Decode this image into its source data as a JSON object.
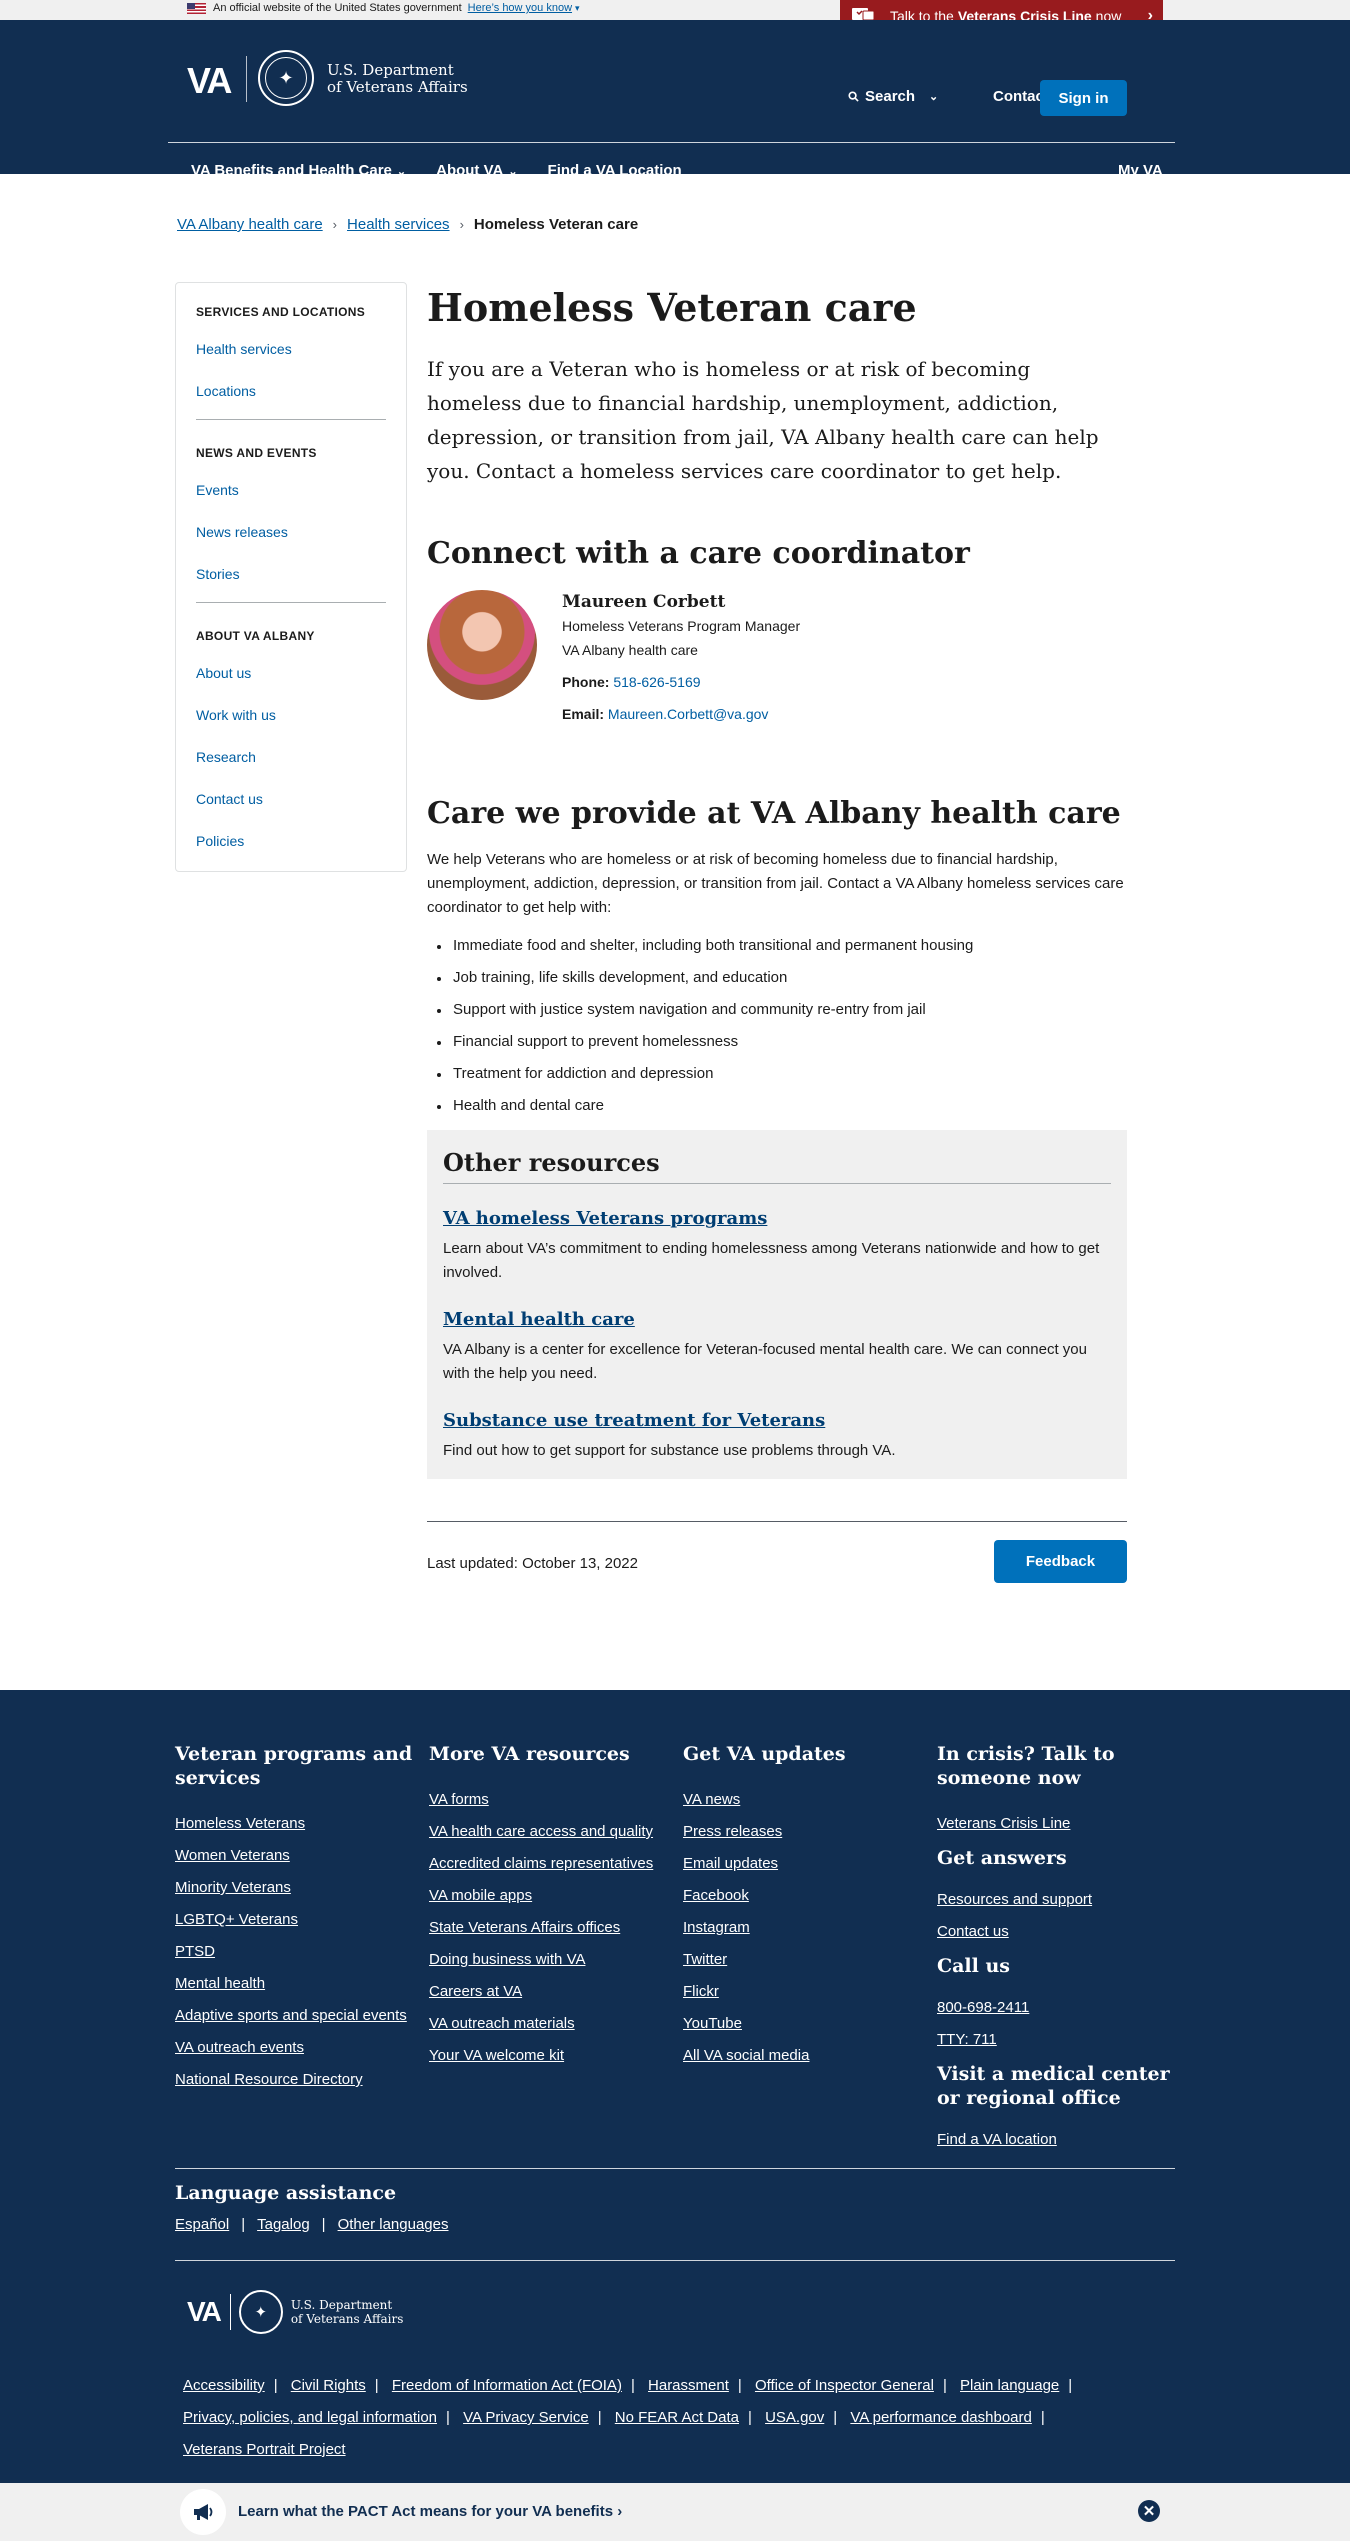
{
  "gov_banner": {
    "text": "An official website of the United States government",
    "how_know": "Here’s how you know"
  },
  "crisis_line": {
    "prefix": "Talk to the",
    "bold": "Veterans Crisis Line",
    "suffix": "now"
  },
  "header": {
    "logo_va": "VA",
    "logo_line1": "U.S. Department",
    "logo_line2": "of Veterans Affairs",
    "search": "Search",
    "contact": "Contact us",
    "signin": "Sign in",
    "nav": [
      "VA Benefits and Health Care",
      "About VA",
      "Find a VA Location"
    ],
    "myva": "My VA"
  },
  "breadcrumb": [
    "VA Albany health care",
    "Health services",
    "Homeless Veteran care"
  ],
  "sidebar": {
    "sections": [
      {
        "title": "SERVICES AND LOCATIONS",
        "links": [
          "Health services",
          "Locations"
        ]
      },
      {
        "title": "NEWS AND EVENTS",
        "links": [
          "Events",
          "News releases",
          "Stories"
        ]
      },
      {
        "title": "ABOUT VA ALBANY",
        "links": [
          "About us",
          "Work with us",
          "Research",
          "Contact us",
          "Policies"
        ]
      }
    ]
  },
  "main": {
    "title": "Homeless Veteran care",
    "lead": "If you are a Veteran who is homeless or at risk of becoming homeless due to financial hardship, unemployment, addiction, depression, or transition from jail, VA Albany health care can help you. Contact a homeless services care coordinator to get help.",
    "connect_heading": "Connect with a care coordinator",
    "coordinator": {
      "name": "Maureen Corbett",
      "role": "Homeless Veterans Program Manager",
      "facility": "VA Albany health care",
      "phone_label": "Phone:",
      "phone": "518-626-5169",
      "email_label": "Email:",
      "email": "Maureen.Corbett@va.gov"
    },
    "care_heading": "Care we provide at VA Albany health care",
    "care_intro": "We help Veterans who are homeless or at risk of becoming homeless due to financial hardship, unemployment, addiction, depression, or transition from jail. Contact a VA Albany homeless services care coordinator to get help with:",
    "care_list": [
      "Immediate food and shelter, including both transitional and permanent housing",
      "Job training, life skills development, and education",
      "Support with justice system navigation and community re-entry from jail",
      "Financial support to prevent homelessness",
      "Treatment for addiction and depression",
      "Health and dental care"
    ],
    "resources": {
      "heading": "Other resources",
      "items": [
        {
          "title": "VA homeless Veterans programs",
          "desc": "Learn about VA’s commitment to ending homelessness among Veterans nationwide and how to get involved."
        },
        {
          "title": "Mental health care",
          "desc": "VA Albany is a center for excellence for Veteran-focused mental health care. We can connect you with the help you need."
        },
        {
          "title": "Substance use treatment for Veterans",
          "desc": "Find out how to get support for substance use problems through VA."
        }
      ]
    },
    "last_updated": "Last updated: October 13, 2022",
    "feedback": "Feedback"
  },
  "footer": {
    "col1": {
      "title": "Veteran programs and services",
      "links": [
        "Homeless Veterans",
        "Women Veterans",
        "Minority Veterans",
        "LGBTQ+ Veterans",
        "PTSD",
        "Mental health",
        "Adaptive sports and special events",
        "VA outreach events",
        "National Resource Directory"
      ]
    },
    "col2": {
      "title": "More VA resources",
      "links": [
        "VA forms",
        "VA health care access and quality",
        "Accredited claims representatives",
        "VA mobile apps",
        "State Veterans Affairs offices",
        "Doing business with VA",
        "Careers at VA",
        "VA outreach materials",
        "Your VA welcome kit"
      ]
    },
    "col3": {
      "title": "Get VA updates",
      "links": [
        "VA news",
        "Press releases",
        "Email updates",
        "Facebook",
        "Instagram",
        "Twitter",
        "Flickr",
        "YouTube",
        "All VA social media"
      ]
    },
    "col4": {
      "crisis_title": "In crisis? Talk to someone now",
      "crisis_link": "Veterans Crisis Line",
      "answers_title": "Get answers",
      "answers_links": [
        "Resources and support",
        "Contact us"
      ],
      "call_title": "Call us",
      "call_links": [
        "800-698-2411",
        "TTY: 711"
      ],
      "visit_title": "Visit a medical center or regional office",
      "visit_link": "Find a VA location"
    },
    "language": {
      "title": "Language assistance",
      "links": [
        "Español",
        "Tagalog",
        "Other languages"
      ]
    },
    "logo_va": "VA",
    "logo_line1": "U.S. Department",
    "logo_line2": "of Veterans Affairs",
    "bottom_links": [
      "Accessibility",
      "Civil Rights",
      "Freedom of Information Act (FOIA)",
      "Harassment",
      "Office of Inspector General",
      "Plain language",
      "Privacy, policies, and legal information",
      "VA Privacy Service",
      "No FEAR Act Data",
      "USA.gov",
      "VA performance dashboard",
      "Veterans Portrait Project"
    ]
  },
  "pact_banner": {
    "text": "Learn what the PACT Act means for your VA benefits"
  }
}
